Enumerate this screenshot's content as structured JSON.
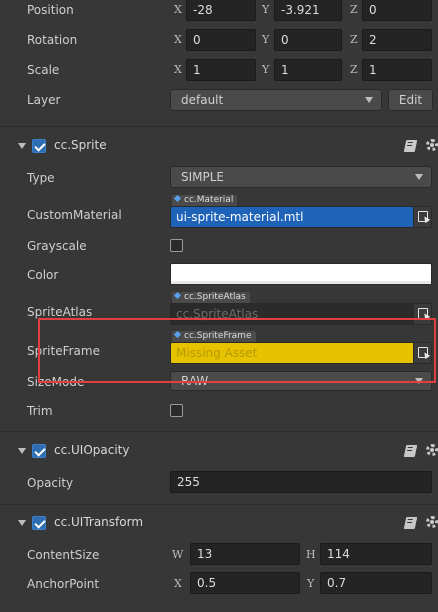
{
  "node": {
    "position": {
      "label": "Position",
      "x_axis": "X",
      "y_axis": "Y",
      "z_axis": "Z",
      "x": "-28",
      "y": "-3.921",
      "z": "0"
    },
    "rotation": {
      "label": "Rotation",
      "x_axis": "X",
      "y_axis": "Y",
      "z_axis": "Z",
      "x": "0",
      "y": "0",
      "z": "2"
    },
    "scale": {
      "label": "Scale",
      "x_axis": "X",
      "y_axis": "Y",
      "z_axis": "Z",
      "x": "1",
      "y": "1",
      "z": "1"
    },
    "layer": {
      "label": "Layer",
      "value": "default",
      "edit_label": "Edit"
    }
  },
  "sprite": {
    "title": "cc.Sprite",
    "enabled": true,
    "type": {
      "label": "Type",
      "value": "SIMPLE"
    },
    "custom_material": {
      "label": "CustomMaterial",
      "tag": "cc.Material",
      "value": "ui-sprite-material.mtl"
    },
    "grayscale": {
      "label": "Grayscale",
      "checked": false
    },
    "color": {
      "label": "Color",
      "value": "#FFFFFF"
    },
    "sprite_atlas": {
      "label": "SpriteAtlas",
      "tag": "cc.SpriteAtlas",
      "placeholder": "cc.SpriteAtlas"
    },
    "sprite_frame": {
      "label": "SpriteFrame",
      "tag": "cc.SpriteFrame",
      "value": "Missing Asset"
    },
    "size_mode": {
      "label": "SizeMode",
      "value": "RAW"
    },
    "trim": {
      "label": "Trim",
      "checked": false
    }
  },
  "ui_opacity": {
    "title": "cc.UIOpacity",
    "enabled": true,
    "opacity": {
      "label": "Opacity",
      "value": "255"
    }
  },
  "ui_transform": {
    "title": "cc.UITransform",
    "enabled": true,
    "content_size": {
      "label": "ContentSize",
      "w_axis": "W",
      "h_axis": "H",
      "w": "13",
      "h": "114"
    },
    "anchor_point": {
      "label": "AnchorPoint",
      "x_axis": "X",
      "y_axis": "Y",
      "x": "0.5",
      "y": "0.7"
    }
  },
  "colors": {
    "background": "#373737",
    "highlight_border": "#e04040",
    "missing_asset_bg": "#e6c200",
    "material_bg": "#1e63b8",
    "checkbox_accent": "#2f6db3"
  }
}
